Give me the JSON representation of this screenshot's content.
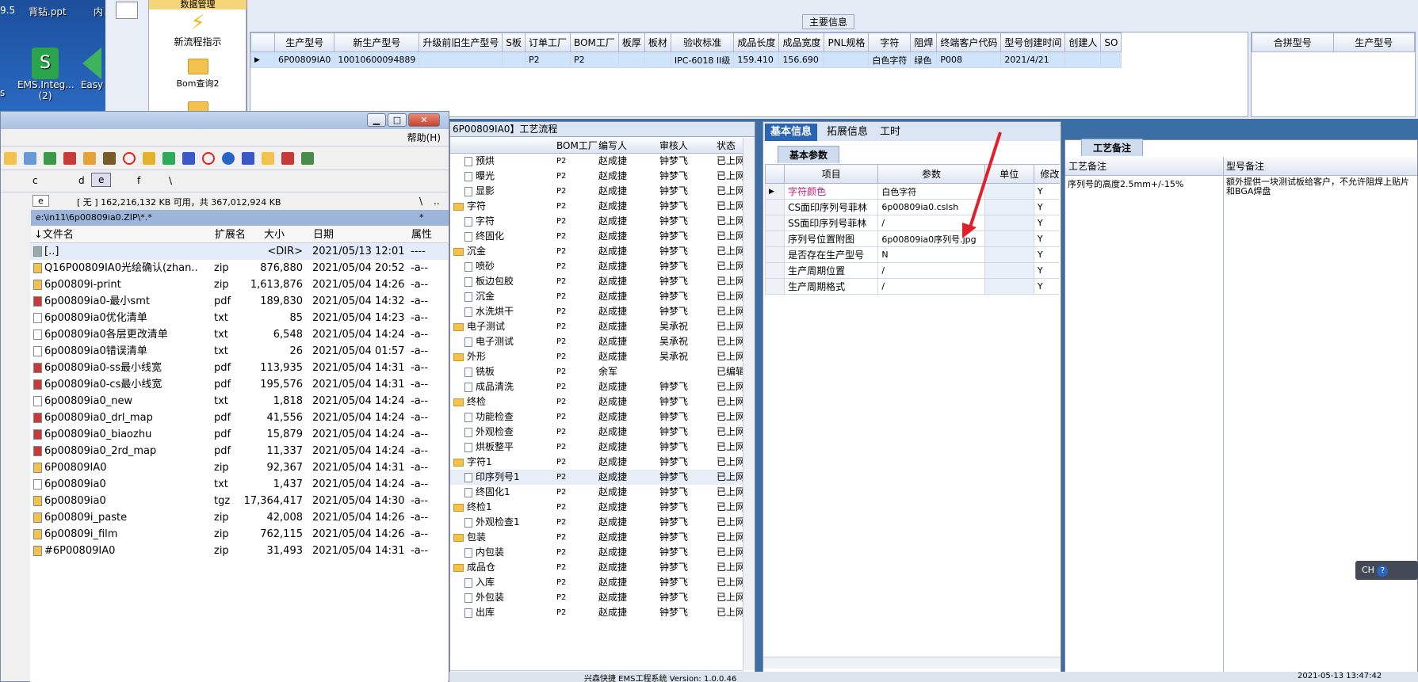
{
  "desktop": {
    "top_left": "9.5",
    "file1": "背钻.ppt",
    "file2": "内",
    "icon_left": "s",
    "icon1": "EMS.Integ...",
    "icon1_sub": "(2)",
    "icon2": "Easy"
  },
  "launcher": {
    "top_label": "数据管理",
    "item1": "新流程指示",
    "item2": "Bom查询2",
    "item3": "..."
  },
  "main_info": {
    "section_title": "主要信息",
    "columns": [
      "生产型号",
      "新生产型号",
      "升级前旧生产型号",
      "S板",
      "订单工厂",
      "BOM工厂",
      "板厚",
      "板材",
      "验收标准",
      "成品长度",
      "成品宽度",
      "PNL规格",
      "字符",
      "阻焊",
      "终端客户代码",
      "型号创建时间",
      "创建人",
      "SO"
    ],
    "row": [
      "6P00809IA0",
      "10010600094889",
      "",
      "",
      "P2",
      "P2",
      "",
      "",
      "IPC-6018 II级",
      "159.410",
      "156.690",
      "",
      "白色字符",
      "绿色",
      "P008",
      "2021/4/21",
      "",
      ""
    ],
    "right_columns": [
      "合拼型号",
      "生产型号"
    ]
  },
  "file_manager": {
    "menu_help": "帮助(H)",
    "drives": [
      "c",
      "d",
      "e",
      "f",
      "\\"
    ],
    "drive_select": "e",
    "free_space": "[ 无 ] 162,216,132 KB 可用，共 367,012,924 KB",
    "path_sep1": "\\",
    "path_sep2": "..",
    "path": "e:\\in11\\6p00809ia0.ZIP\\*.*",
    "path_star": "*",
    "columns": [
      "文件名",
      "扩展名",
      "大小",
      "日期",
      "属性"
    ],
    "files": [
      {
        "name": "[..]",
        "ext": "",
        "size": "<DIR>",
        "date": "2021/05/13 12:01",
        "attr": "----"
      },
      {
        "name": "Q16P00809IA0光绘确认(zhan..",
        "ext": "zip",
        "size": "876,880",
        "date": "2021/05/04 20:52",
        "attr": "-a--"
      },
      {
        "name": "6p00809i-print",
        "ext": "zip",
        "size": "1,613,876",
        "date": "2021/05/04 14:26",
        "attr": "-a--"
      },
      {
        "name": "6p00809ia0-最小smt",
        "ext": "pdf",
        "size": "189,830",
        "date": "2021/05/04 14:32",
        "attr": "-a--"
      },
      {
        "name": "6p00809ia0优化清单",
        "ext": "txt",
        "size": "85",
        "date": "2021/05/04 14:23",
        "attr": "-a--"
      },
      {
        "name": "6p00809ia0各层更改清单",
        "ext": "txt",
        "size": "6,548",
        "date": "2021/05/04 14:24",
        "attr": "-a--"
      },
      {
        "name": "6p00809ia0错误清单",
        "ext": "txt",
        "size": "26",
        "date": "2021/05/04 01:57",
        "attr": "-a--"
      },
      {
        "name": "6p00809ia0-ss最小线宽",
        "ext": "pdf",
        "size": "113,935",
        "date": "2021/05/04 14:31",
        "attr": "-a--"
      },
      {
        "name": "6p00809ia0-cs最小线宽",
        "ext": "pdf",
        "size": "195,576",
        "date": "2021/05/04 14:31",
        "attr": "-a--"
      },
      {
        "name": "6p00809ia0_new",
        "ext": "txt",
        "size": "1,818",
        "date": "2021/05/04 14:24",
        "attr": "-a--"
      },
      {
        "name": "6p00809ia0_drl_map",
        "ext": "pdf",
        "size": "41,556",
        "date": "2021/05/04 14:24",
        "attr": "-a--"
      },
      {
        "name": "6p00809ia0_biaozhu",
        "ext": "pdf",
        "size": "15,879",
        "date": "2021/05/04 14:24",
        "attr": "-a--"
      },
      {
        "name": "6p00809ia0_2rd_map",
        "ext": "pdf",
        "size": "11,337",
        "date": "2021/05/04 14:24",
        "attr": "-a--"
      },
      {
        "name": "6P00809IA0",
        "ext": "zip",
        "size": "92,367",
        "date": "2021/05/04 14:31",
        "attr": "-a--"
      },
      {
        "name": "6p00809ia0",
        "ext": "txt",
        "size": "1,437",
        "date": "2021/05/04 14:24",
        "attr": "-a--"
      },
      {
        "name": "6p00809ia0",
        "ext": "tgz",
        "size": "17,364,417",
        "date": "2021/05/04 14:30",
        "attr": "-a--"
      },
      {
        "name": "6p00809i_paste",
        "ext": "zip",
        "size": "42,008",
        "date": "2021/05/04 14:26",
        "attr": "-a--"
      },
      {
        "name": "6p00809i_film",
        "ext": "zip",
        "size": "762,115",
        "date": "2021/05/04 14:26",
        "attr": "-a--"
      },
      {
        "name": "#6P00809IA0",
        "ext": "zip",
        "size": "31,493",
        "date": "2021/05/04 14:31",
        "attr": "-a--"
      }
    ]
  },
  "process": {
    "title": "6P00809IA0】工艺流程",
    "columns": [
      "BOM工厂",
      "编写人",
      "审核人",
      "状态"
    ],
    "rows": [
      {
        "name": "预烘",
        "type": "doc",
        "bom": "P2",
        "writer": "赵成捷",
        "reviewer": "钟梦飞",
        "status": "已上网"
      },
      {
        "name": "曝光",
        "type": "doc",
        "bom": "P2",
        "writer": "赵成捷",
        "reviewer": "钟梦飞",
        "status": "已上网"
      },
      {
        "name": "显影",
        "type": "doc",
        "bom": "P2",
        "writer": "赵成捷",
        "reviewer": "钟梦飞",
        "status": "已上网"
      },
      {
        "name": "字符",
        "type": "folder",
        "bom": "P2",
        "writer": "赵成捷",
        "reviewer": "钟梦飞",
        "status": "已上网"
      },
      {
        "name": "字符",
        "type": "doc",
        "bom": "P2",
        "writer": "赵成捷",
        "reviewer": "钟梦飞",
        "status": "已上网"
      },
      {
        "name": "终固化",
        "type": "doc",
        "bom": "P2",
        "writer": "赵成捷",
        "reviewer": "钟梦飞",
        "status": "已上网"
      },
      {
        "name": "沉金",
        "type": "folder",
        "bom": "P2",
        "writer": "赵成捷",
        "reviewer": "钟梦飞",
        "status": "已上网"
      },
      {
        "name": "喷砂",
        "type": "doc",
        "bom": "P2",
        "writer": "赵成捷",
        "reviewer": "钟梦飞",
        "status": "已上网"
      },
      {
        "name": "板边包胶",
        "type": "doc",
        "bom": "P2",
        "writer": "赵成捷",
        "reviewer": "钟梦飞",
        "status": "已上网"
      },
      {
        "name": "沉金",
        "type": "doc",
        "bom": "P2",
        "writer": "赵成捷",
        "reviewer": "钟梦飞",
        "status": "已上网"
      },
      {
        "name": "水洗烘干",
        "type": "doc",
        "bom": "P2",
        "writer": "赵成捷",
        "reviewer": "钟梦飞",
        "status": "已上网"
      },
      {
        "name": "电子测试",
        "type": "folder",
        "bom": "P2",
        "writer": "赵成捷",
        "reviewer": "吴承祝",
        "status": "已上网"
      },
      {
        "name": "电子测试",
        "type": "doc",
        "bom": "P2",
        "writer": "赵成捷",
        "reviewer": "吴承祝",
        "status": "已上网"
      },
      {
        "name": "外形",
        "type": "folder",
        "bom": "P2",
        "writer": "赵成捷",
        "reviewer": "吴承祝",
        "status": "已上网"
      },
      {
        "name": "铣板",
        "type": "doc",
        "bom": "P2",
        "writer": "余军",
        "reviewer": "",
        "status": "已编辑"
      },
      {
        "name": "成品清洗",
        "type": "doc",
        "bom": "P2",
        "writer": "赵成捷",
        "reviewer": "钟梦飞",
        "status": "已上网"
      },
      {
        "name": "终检",
        "type": "folder",
        "bom": "P2",
        "writer": "赵成捷",
        "reviewer": "钟梦飞",
        "status": "已上网"
      },
      {
        "name": "功能检查",
        "type": "doc",
        "bom": "P2",
        "writer": "赵成捷",
        "reviewer": "钟梦飞",
        "status": "已上网"
      },
      {
        "name": "外观检查",
        "type": "doc",
        "bom": "P2",
        "writer": "赵成捷",
        "reviewer": "钟梦飞",
        "status": "已上网"
      },
      {
        "name": "烘板整平",
        "type": "doc",
        "bom": "P2",
        "writer": "赵成捷",
        "reviewer": "钟梦飞",
        "status": "已上网"
      },
      {
        "name": "字符1",
        "type": "folder",
        "bom": "P2",
        "writer": "赵成捷",
        "reviewer": "钟梦飞",
        "status": "已上网"
      },
      {
        "name": "印序列号1",
        "type": "doc",
        "bom": "P2",
        "writer": "赵成捷",
        "reviewer": "钟梦飞",
        "status": "已上网"
      },
      {
        "name": "终固化1",
        "type": "doc",
        "bom": "P2",
        "writer": "赵成捷",
        "reviewer": "钟梦飞",
        "status": "已上网"
      },
      {
        "name": "终检1",
        "type": "folder",
        "bom": "P2",
        "writer": "赵成捷",
        "reviewer": "钟梦飞",
        "status": "已上网"
      },
      {
        "name": "外观检查1",
        "type": "doc",
        "bom": "P2",
        "writer": "赵成捷",
        "reviewer": "钟梦飞",
        "status": "已上网"
      },
      {
        "name": "包装",
        "type": "folder",
        "bom": "P2",
        "writer": "赵成捷",
        "reviewer": "钟梦飞",
        "status": "已上网"
      },
      {
        "name": "内包装",
        "type": "doc",
        "bom": "P2",
        "writer": "赵成捷",
        "reviewer": "钟梦飞",
        "status": "已上网"
      },
      {
        "name": "成品仓",
        "type": "folder",
        "bom": "P2",
        "writer": "赵成捷",
        "reviewer": "钟梦飞",
        "status": "已上网"
      },
      {
        "name": "入库",
        "type": "doc",
        "bom": "P2",
        "writer": "赵成捷",
        "reviewer": "钟梦飞",
        "status": "已上网"
      },
      {
        "name": "外包装",
        "type": "doc",
        "bom": "P2",
        "writer": "赵成捷",
        "reviewer": "钟梦飞",
        "status": "已上网"
      },
      {
        "name": "出库",
        "type": "doc",
        "bom": "P2",
        "writer": "赵成捷",
        "reviewer": "钟梦飞",
        "status": "已上网"
      }
    ]
  },
  "basic_info": {
    "tabs": [
      "基本信息",
      "拓展信息",
      "工时"
    ],
    "subtab": "基本参数",
    "columns": [
      "项目",
      "参数",
      "单位",
      "修改"
    ],
    "rows": [
      {
        "item": "字符颜色",
        "param": "白色字符",
        "unit": "",
        "mod": "Y"
      },
      {
        "item": "CS面印序列号菲林",
        "param": "6p00809ia0.cslsh",
        "unit": "",
        "mod": "Y"
      },
      {
        "item": "SS面印序列号菲林",
        "param": "/",
        "unit": "",
        "mod": "Y"
      },
      {
        "item": "序列号位置附图",
        "param": "6p00809ia0序列号.jpg",
        "unit": "",
        "mod": "Y"
      },
      {
        "item": "是否存在生产型号",
        "param": "N",
        "unit": "",
        "mod": "Y"
      },
      {
        "item": "生产周期位置",
        "param": "/",
        "unit": "",
        "mod": "Y"
      },
      {
        "item": "生产周期格式",
        "param": "/",
        "unit": "",
        "mod": "Y"
      }
    ]
  },
  "notes": {
    "tab": "工艺备注",
    "col1": "工艺备注",
    "col2": "型号备注",
    "note1": "序列号的高度2.5mm+/-15%",
    "note2": "额外提供一块测试板给客户，不允许阻焊上贴片和BGA焊盘"
  },
  "status_bar": {
    "center": "兴森快捷 EMS工程系统 Version: 1.0.0.46",
    "clock": "2021-05-13 13:47:42"
  },
  "ime": {
    "label": "CH"
  },
  "colors": {
    "selection": "#cfe3fb",
    "tab_active": "#2a64b5",
    "arrow": "#e0202a",
    "header": "#dde5f2"
  }
}
